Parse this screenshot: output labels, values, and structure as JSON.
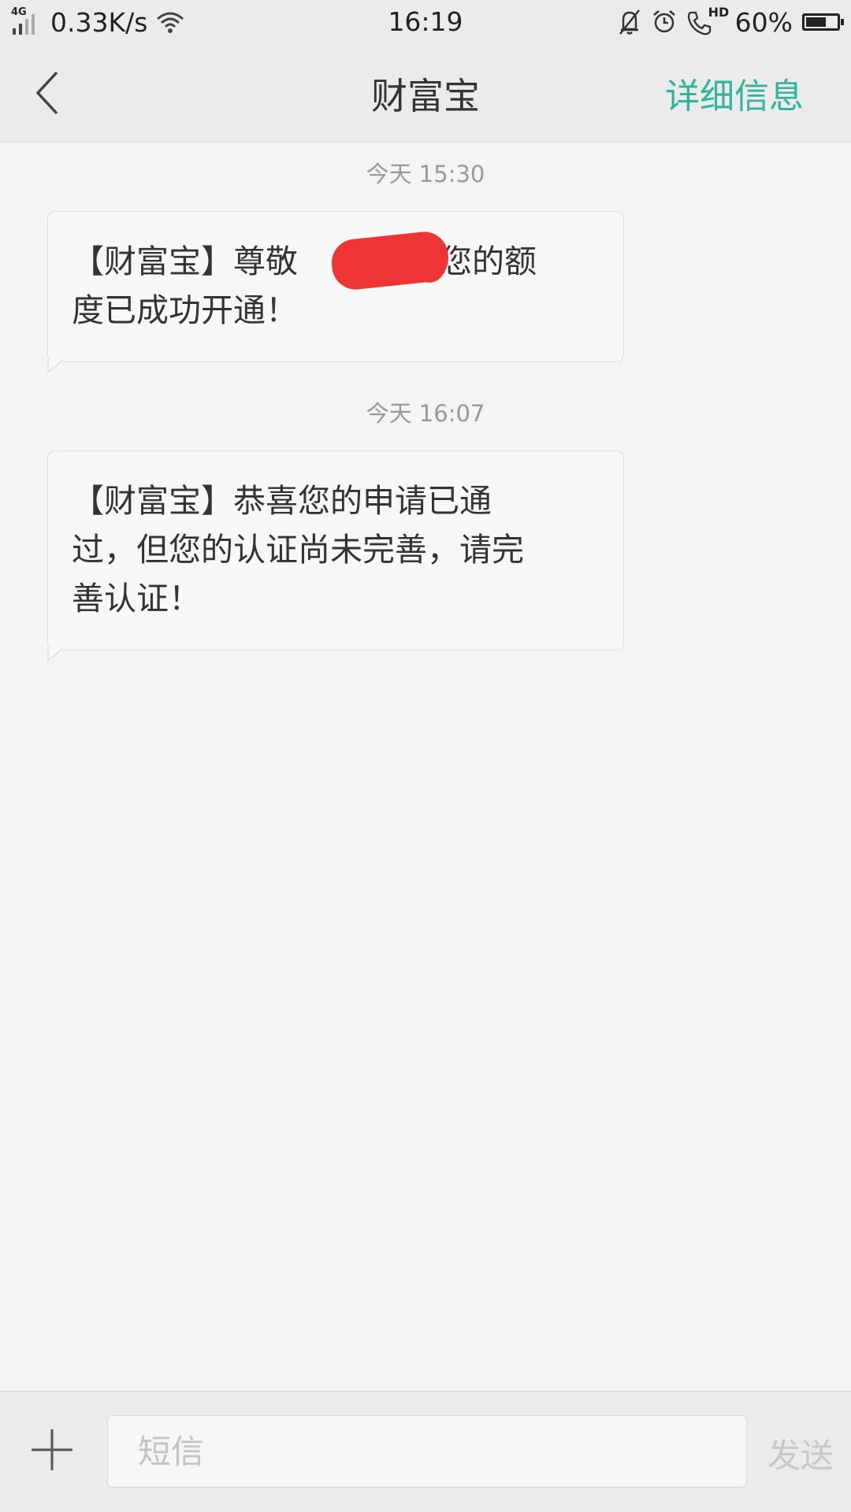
{
  "status_bar": {
    "network_type": "4G",
    "speed": "0.33K/s",
    "time": "16:19",
    "hd_label": "HD",
    "battery": "60%"
  },
  "header": {
    "title": "财富宝",
    "detail_label": "详细信息"
  },
  "messages": [
    {
      "timestamp": "今天  15:30",
      "line1_a": "【财富宝】尊敬",
      "line1_b": "您的额",
      "line2": "度已成功开通！"
    },
    {
      "timestamp": "今天  16:07",
      "lines": [
        "【财富宝】恭喜您的申请已通",
        "过，但您的认证尚未完善，请完",
        "善认证！"
      ]
    }
  ],
  "input_bar": {
    "placeholder": "短信",
    "send_label": "发送"
  },
  "colors": {
    "accent": "#2fb59d",
    "redaction": "#ee3434"
  },
  "icons": [
    "signal-icon",
    "wifi-icon",
    "mute-icon",
    "alarm-icon",
    "call-hd-icon",
    "battery-icon",
    "back-icon",
    "add-icon"
  ]
}
